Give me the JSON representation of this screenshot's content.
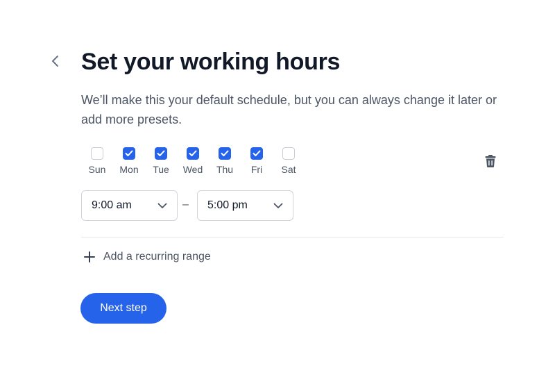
{
  "header": {
    "title": "Set your working hours",
    "subtitle": "We’ll make this your default schedule, but you can always change it later or add more presets."
  },
  "days": [
    {
      "label": "Sun",
      "checked": false
    },
    {
      "label": "Mon",
      "checked": true
    },
    {
      "label": "Tue",
      "checked": true
    },
    {
      "label": "Wed",
      "checked": true
    },
    {
      "label": "Thu",
      "checked": true
    },
    {
      "label": "Fri",
      "checked": true
    },
    {
      "label": "Sat",
      "checked": false
    }
  ],
  "range": {
    "start": "9:00 am",
    "separator": "–",
    "end": "5:00 pm"
  },
  "actions": {
    "add_range_label": "Add a recurring range",
    "next_label": "Next step"
  },
  "colors": {
    "accent": "#2563eb",
    "text_primary": "#111827",
    "text_secondary": "#4b5563",
    "border": "#d1d5db"
  },
  "icons": {
    "back": "chevron-left-icon",
    "delete": "trash-icon",
    "dropdown": "chevron-down-icon",
    "add": "plus-icon",
    "check": "check-icon"
  }
}
